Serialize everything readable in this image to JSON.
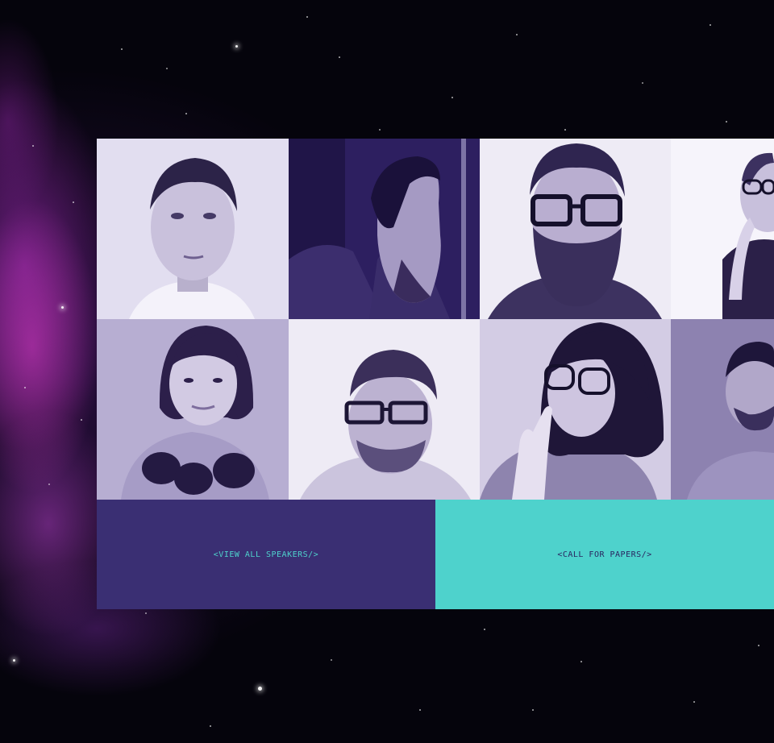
{
  "colors": {
    "speakers_bg": "#3a2f73",
    "speakers_text": "#4fd2cc",
    "papers_bg": "#4ed2cc",
    "papers_text": "#2a2560",
    "photo_tint": "#3b2a6e"
  },
  "speakers": [
    {
      "photo": "speaker-photo-man-short-hair"
    },
    {
      "photo": "speaker-photo-man-profile-dark"
    },
    {
      "photo": "speaker-photo-man-beard-glasses"
    },
    {
      "photo": "speaker-photo-woman-glasses-partial"
    },
    {
      "photo": "speaker-photo-woman-bob-hair"
    },
    {
      "photo": "speaker-photo-man-glasses-beard"
    },
    {
      "photo": "speaker-photo-woman-glasses-finger"
    },
    {
      "photo": "speaker-photo-man-dark-hair-partial"
    }
  ],
  "actions": {
    "view_all_speakers": "<VIEW ALL SPEAKERS/>",
    "call_for_papers": "<CALL FOR PAPERS/>"
  }
}
